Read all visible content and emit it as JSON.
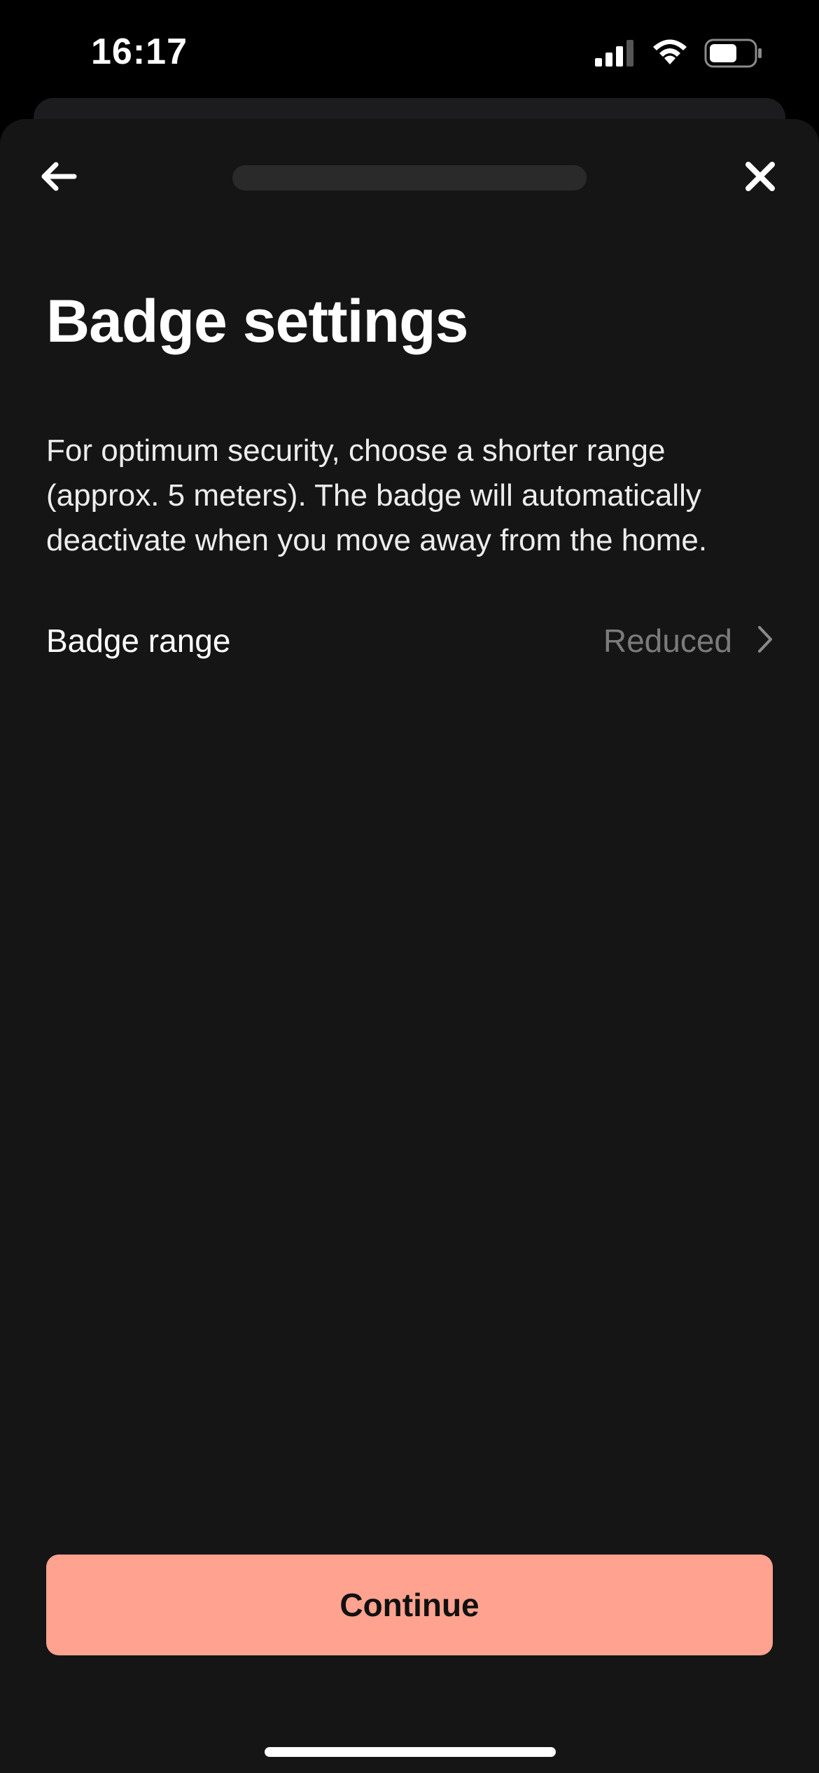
{
  "status_bar": {
    "time": "16:17",
    "icons": [
      "signal-icon",
      "wifi-icon",
      "battery-icon"
    ]
  },
  "nav": {
    "back_icon": "arrow-left-icon",
    "close_icon": "close-icon",
    "progress_fraction": 1.0
  },
  "page": {
    "title": "Badge settings",
    "description": "For optimum security, choose a shorter range (approx. 5 meters). The badge will automatically deactivate when you move away from the home."
  },
  "settings": {
    "badge_range": {
      "label": "Badge range",
      "value": "Reduced"
    }
  },
  "footer": {
    "continue_label": "Continue"
  },
  "colors": {
    "background": "#151515",
    "accent": "#ffa390",
    "muted_text": "#7b7b7b"
  }
}
